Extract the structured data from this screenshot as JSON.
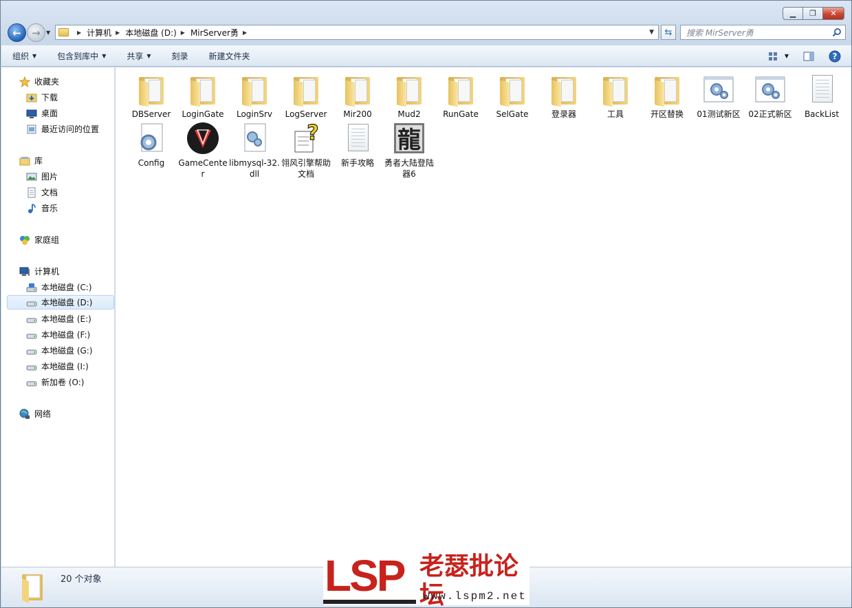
{
  "window": {
    "caption": {
      "minimize": "▁",
      "maximize": "❐",
      "close": "✕"
    }
  },
  "address": {
    "crumbs": [
      "计算机",
      "本地磁盘 (D:)",
      "MirServer勇"
    ],
    "search_placeholder": "搜索 MirServer勇"
  },
  "toolbar": {
    "organize": "组织",
    "include_in_library": "包含到库中",
    "share": "共享",
    "burn": "刻录",
    "new_folder": "新建文件夹"
  },
  "navpane": {
    "favorites": "收藏夹",
    "downloads": "下载",
    "desktop": "桌面",
    "recent": "最近访问的位置",
    "libraries": "库",
    "pictures": "图片",
    "documents": "文档",
    "music": "音乐",
    "homegroup": "家庭组",
    "computer": "计算机",
    "drives": [
      "本地磁盘 (C:)",
      "本地磁盘 (D:)",
      "本地磁盘 (E:)",
      "本地磁盘 (F:)",
      "本地磁盘 (G:)",
      "本地磁盘 (I:)",
      "新加卷 (O:)"
    ],
    "network": "网络"
  },
  "files": [
    {
      "name": "DBServer",
      "type": "folder"
    },
    {
      "name": "LoginGate",
      "type": "folder"
    },
    {
      "name": "LoginSrv",
      "type": "folder"
    },
    {
      "name": "LogServer",
      "type": "folder"
    },
    {
      "name": "Mir200",
      "type": "folder"
    },
    {
      "name": "Mud2",
      "type": "folder"
    },
    {
      "name": "RunGate",
      "type": "folder"
    },
    {
      "name": "SelGate",
      "type": "folder"
    },
    {
      "name": "登录器",
      "type": "folder"
    },
    {
      "name": "工具",
      "type": "folder"
    },
    {
      "name": "开区替换",
      "type": "folder"
    },
    {
      "name": "01测试新区",
      "type": "shortcut"
    },
    {
      "name": "02正式新区",
      "type": "shortcut"
    },
    {
      "name": "BackList",
      "type": "text"
    },
    {
      "name": "Config",
      "type": "config"
    },
    {
      "name": "GameCenter",
      "type": "app"
    },
    {
      "name": "libmysql-32.dll",
      "type": "dll"
    },
    {
      "name": "翎风引擎帮助文档",
      "type": "help"
    },
    {
      "name": "新手攻略",
      "type": "text"
    },
    {
      "name": "勇者大陆登陆器6",
      "type": "app2"
    }
  ],
  "status": {
    "count": "20 个对象"
  },
  "watermark": {
    "brand": "LSP",
    "title": "老瑟批论坛",
    "url": "www.lspm2.net"
  },
  "colors": {
    "accent": "#2363b7",
    "close": "#c74834",
    "brand": "#c8221d"
  }
}
